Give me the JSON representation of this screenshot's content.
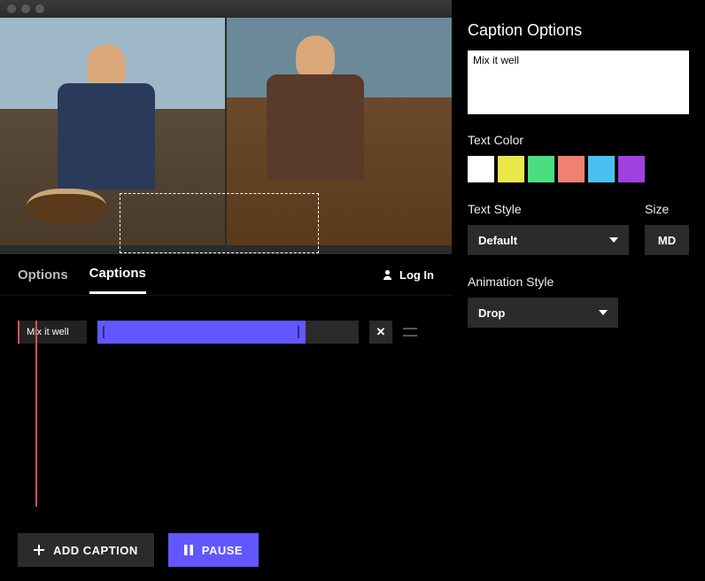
{
  "tabs": {
    "options": "Options",
    "captions": "Captions"
  },
  "login": "Log In",
  "timeline": {
    "caption_label": "Mix it well"
  },
  "buttons": {
    "add_caption": "Add Caption",
    "pause": "Pause"
  },
  "panel": {
    "title": "Caption Options",
    "caption_value": "Mix it well",
    "text_color_label": "Text Color",
    "colors": [
      "#ffffff",
      "#e8e84a",
      "#4ade80",
      "#f08070",
      "#4ac0f0",
      "#a040e0"
    ],
    "text_style_label": "Text Style",
    "text_style_value": "Default",
    "size_label": "Size",
    "size_value": "MD",
    "animation_label": "Animation Style",
    "animation_value": "Drop"
  }
}
